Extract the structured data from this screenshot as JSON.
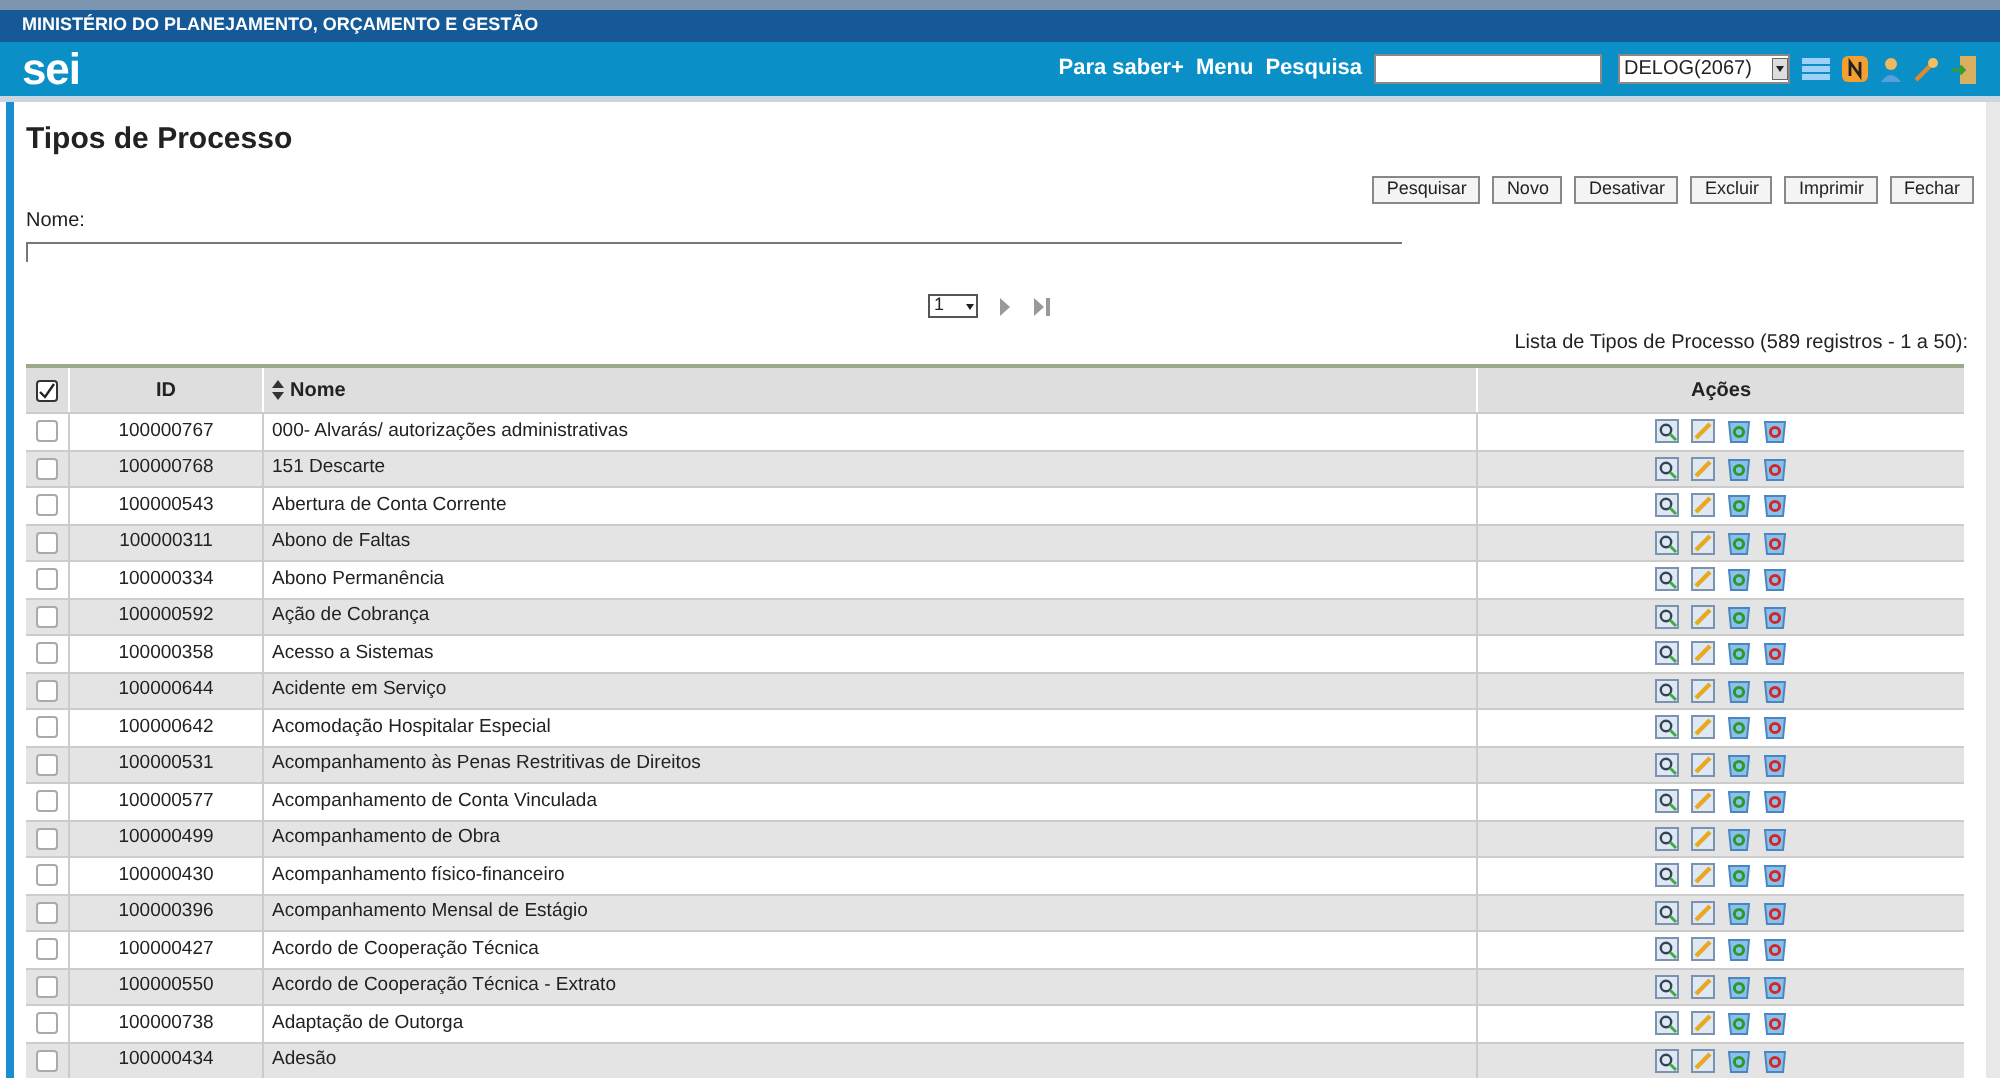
{
  "header": {
    "org": "MINISTÉRIO DO PLANEJAMENTO, ORÇAMENTO E GESTÃO",
    "logo": "sei",
    "links": [
      "Para saber+",
      "Menu",
      "Pesquisa"
    ],
    "unit": "DELOG(2067)"
  },
  "page": {
    "title": "Tipos de Processo",
    "buttons": [
      "Pesquisar",
      "Novo",
      "Desativar",
      "Excluir",
      "Imprimir",
      "Fechar"
    ],
    "filter_label": "Nome:",
    "page_select": "1",
    "caption": "Lista de Tipos de Processo (589 registros - 1 a 50):"
  },
  "table": {
    "select_all_checked": true,
    "columns": [
      "ID",
      "Nome",
      "Ações"
    ],
    "rows": [
      {
        "id": "100000767",
        "name": "000- Alvarás/ autorizações administrativas",
        "checked": false
      },
      {
        "id": "100000768",
        "name": "151 Descarte",
        "checked": false
      },
      {
        "id": "100000543",
        "name": "Abertura de Conta Corrente",
        "checked": false
      },
      {
        "id": "100000311",
        "name": "Abono de Faltas",
        "checked": false
      },
      {
        "id": "100000334",
        "name": "Abono Permanência",
        "checked": false
      },
      {
        "id": "100000592",
        "name": "Ação de Cobrança",
        "checked": false
      },
      {
        "id": "100000358",
        "name": "Acesso a Sistemas",
        "checked": false
      },
      {
        "id": "100000644",
        "name": "Acidente em Serviço",
        "checked": false
      },
      {
        "id": "100000642",
        "name": "Acomodação Hospitalar Especial",
        "checked": false
      },
      {
        "id": "100000531",
        "name": "Acompanhamento às Penas Restritivas de Direitos",
        "checked": false
      },
      {
        "id": "100000577",
        "name": "Acompanhamento de Conta Vinculada",
        "checked": false
      },
      {
        "id": "100000499",
        "name": "Acompanhamento de Obra",
        "checked": false
      },
      {
        "id": "100000430",
        "name": "Acompanhamento físico-financeiro",
        "checked": false
      },
      {
        "id": "100000396",
        "name": "Acompanhamento Mensal de Estágio",
        "checked": false
      },
      {
        "id": "100000427",
        "name": "Acordo de Cooperação Técnica",
        "checked": false
      },
      {
        "id": "100000550",
        "name": "Acordo de Cooperação Técnica - Extrato",
        "checked": false
      },
      {
        "id": "100000738",
        "name": "Adaptação de Outorga",
        "checked": false
      },
      {
        "id": "100000434",
        "name": "Adesão",
        "checked": false
      }
    ]
  }
}
